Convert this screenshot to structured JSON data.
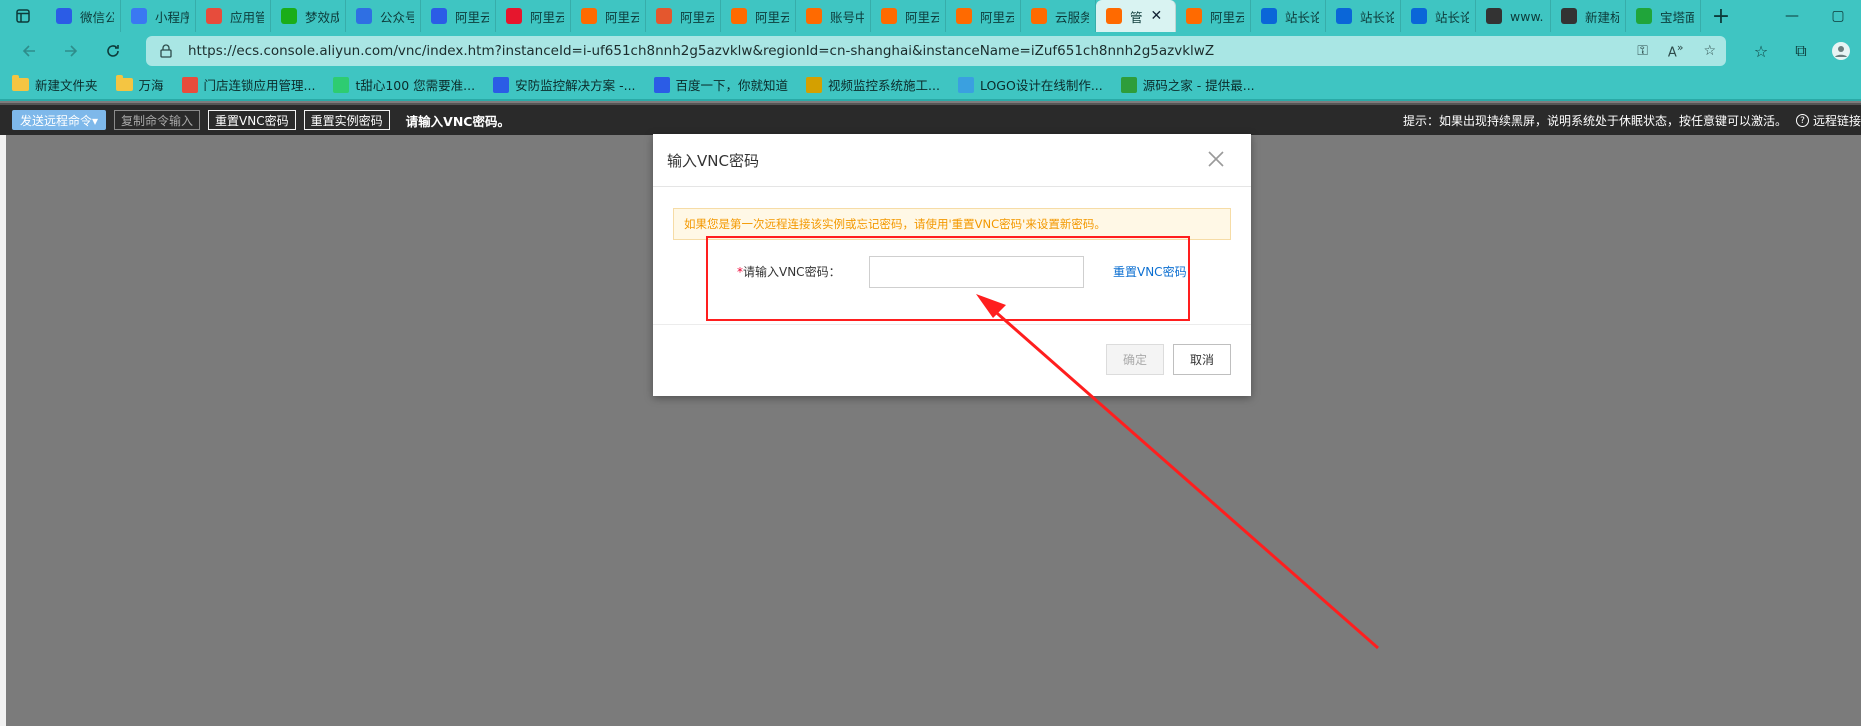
{
  "browser": {
    "tabs": [
      {
        "label": "微信公",
        "icon": "baidu-icon",
        "color": "#2b5ce6"
      },
      {
        "label": "小程序",
        "icon": "link-icon",
        "color": "#3a78f2"
      },
      {
        "label": "应用管",
        "icon": "grid-icon",
        "color": "#e74c3c"
      },
      {
        "label": "梦效成",
        "icon": "wechat-icon",
        "color": "#1aad19"
      },
      {
        "label": "公众号",
        "icon": "doc-icon",
        "color": "#2f6fe3"
      },
      {
        "label": "阿里云",
        "icon": "baidu-icon",
        "color": "#2b5ce6"
      },
      {
        "label": "阿里云",
        "icon": "weibo-icon",
        "color": "#e6162d"
      },
      {
        "label": "阿里云",
        "icon": "aliyun-icon",
        "color": "#ff6a00"
      },
      {
        "label": "阿里云",
        "icon": "c-icon",
        "color": "#e4572e"
      },
      {
        "label": "阿里云",
        "icon": "aliyun-icon",
        "color": "#ff6a00"
      },
      {
        "label": "账号中",
        "icon": "aliyun-icon",
        "color": "#ff6a00"
      },
      {
        "label": "阿里云",
        "icon": "aliyun-icon",
        "color": "#ff6a00"
      },
      {
        "label": "阿里云",
        "icon": "aliyun-icon",
        "color": "#ff6a00"
      },
      {
        "label": "云服务",
        "icon": "aliyun-icon",
        "color": "#ff6a00"
      },
      {
        "label": "管",
        "icon": "aliyun-icon",
        "color": "#ff6a00",
        "active": true
      },
      {
        "label": "阿里云",
        "icon": "aliyun-icon",
        "color": "#ff6a00"
      },
      {
        "label": "站长论",
        "icon": "zhihu-icon",
        "color": "#0a66d8"
      },
      {
        "label": "站长论",
        "icon": "zhihu-icon",
        "color": "#0a66d8"
      },
      {
        "label": "站长论",
        "icon": "zhihu-icon",
        "color": "#0a66d8"
      },
      {
        "label": "www.s",
        "icon": "page-icon",
        "color": "#333333"
      },
      {
        "label": "新建标",
        "icon": "page-icon",
        "color": "#333333"
      },
      {
        "label": "宝塔面",
        "icon": "shield-icon",
        "color": "#20a53a"
      }
    ],
    "url": "https://ecs.console.aliyun.com/vnc/index.htm?instanceId=i-uf651ch8nnh2g5azvklw&regionId=cn-shanghai&instanceName=iZuf651ch8nnh2g5azvklwZ",
    "bookmarks": [
      {
        "label": "新建文件夹",
        "icon": "folder-icon"
      },
      {
        "label": "万海",
        "icon": "folder-icon"
      },
      {
        "label": "门店连锁应用管理...",
        "icon": "grid-icon",
        "color": "#e74c3c"
      },
      {
        "label": "t甜心100 您需要准...",
        "icon": "leaf-icon",
        "color": "#2ecc71"
      },
      {
        "label": "安防监控解决方案 -...",
        "icon": "baidu-icon",
        "color": "#2b5ce6"
      },
      {
        "label": "百度一下，你就知道",
        "icon": "baidu-icon",
        "color": "#2b5ce6"
      },
      {
        "label": "视频监控系统施工...",
        "icon": "s-icon",
        "color": "#d4a000"
      },
      {
        "label": "LOGO设计在线制作...",
        "icon": "logo-icon",
        "color": "#3aa0e0"
      },
      {
        "label": "源码之家 - 提供最...",
        "icon": "m-icon",
        "color": "#2e9d3a"
      }
    ]
  },
  "vnc_toolbar": {
    "send_command": "发送远程命令▾",
    "copy_command": "复制命令输入",
    "reset_vnc": "重置VNC密码",
    "reset_instance": "重置实例密码",
    "message": "请输入VNC密码。",
    "hint": "提示：如果出现持续黑屏，说明系统处于休眠状态，按任意键可以激活。",
    "help": "远程链接"
  },
  "modal": {
    "title": "输入VNC密码",
    "alert": "如果您是第一次远程连接该实例或忘记密码，请使用'重置VNC密码'来设置新密码。",
    "field_label_required": "*",
    "field_label": "请输入VNC密码：",
    "input_value": "",
    "reset_link": "重置VNC密码",
    "ok_label": "确定",
    "cancel_label": "取消"
  },
  "colors": {
    "browser_chrome": "#3fc5c2",
    "annotation_red": "#ff1e1e",
    "link_blue": "#0a6ed1",
    "alert_orange": "#f39800"
  }
}
